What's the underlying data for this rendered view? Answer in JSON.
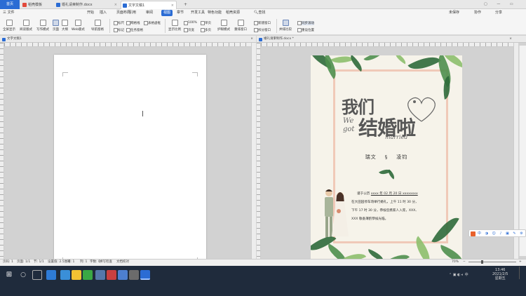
{
  "titlebar": {
    "home": "首页",
    "tabs": [
      {
        "label": "稻壳模板",
        "active": false
      },
      {
        "label": "婚礼请柬制作.docx",
        "active": false
      },
      {
        "label": "文字文稿1",
        "active": true
      }
    ],
    "add": "+"
  },
  "menubar": {
    "file": "三 文件",
    "items": [
      "开始",
      "插入",
      "页面布局",
      "引用",
      "审阅",
      "视图",
      "章节",
      "开发工具",
      "特色功能",
      "稻壳资源"
    ],
    "active_index": 5,
    "search": "查找",
    "right": [
      "未保存",
      "协作",
      "分享"
    ]
  },
  "ribbon": {
    "big": [
      "全屏显示",
      "阅读版式",
      "写作模式",
      "页面",
      "大纲",
      "Web版式",
      "导航窗格"
    ],
    "checks_a": [
      "标尺",
      "网格线",
      "标记",
      "任务窗格"
    ],
    "checks_b": [
      "表格虚框"
    ],
    "zoom": [
      "显示比例",
      "100%",
      "单页",
      "多页",
      "页宽"
    ],
    "more": [
      "护眼模式",
      "重排窗口",
      "新建窗口",
      "拆分窗口"
    ],
    "right": [
      "并排比较",
      "同步滚动",
      "重设位置"
    ]
  },
  "left_pane": {
    "title": "文字文稿1",
    "close": "×"
  },
  "right_pane": {
    "title": "婚礼请柬制作.docx *",
    "close": "×"
  },
  "invitation": {
    "title_cn_1": "我们",
    "title_cn_2": "结婚啦",
    "we": "We",
    "got": "got",
    "married": "married",
    "groom": "瑞文",
    "amp": "§",
    "bride": "凌钧",
    "line1_pre": "谨于公历 ",
    "line1_date": "xxxx 年 02 月 20 日",
    "line1_post": " xxxxxxxx",
    "line2": "在大田园停车场举行婚礼，上午 11 时 30 分，",
    "line3": "下午 17 时 30 分，恭候您携家人入席，XXX、",
    "line4": "XXX 敬备薄酌恭候光临。"
  },
  "statusbar": {
    "left": [
      "页码: 1",
      "页面: 1/1",
      "节: 1/1",
      "设置值: 2.5厘米",
      "行: 1",
      "列: 1",
      "字数: 0",
      "拼写检查",
      "文档校对"
    ],
    "zoom": "70%",
    "minus": "−",
    "plus": "+"
  },
  "taskbar": {
    "time": "13:46",
    "date": "2021/2/5",
    "day": "星期五"
  },
  "colors": {
    "accent": "#2b6cd4",
    "frame": "#f0c9b8",
    "leaf": "#4f8f4e"
  }
}
